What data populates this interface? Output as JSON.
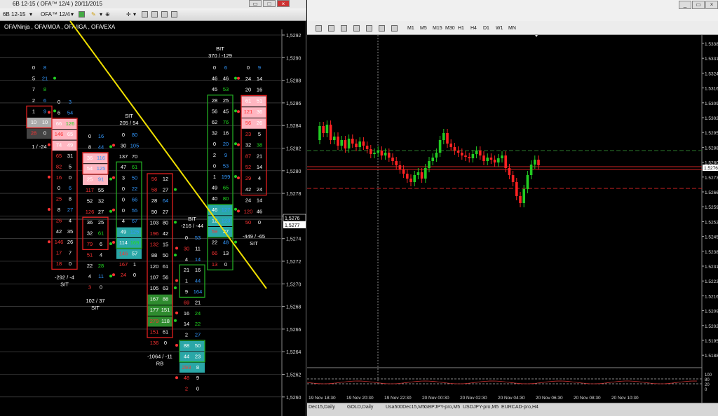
{
  "left": {
    "title": "6B 12-15 ( OFA™ 12/4 )  20/11/2015",
    "toolbar": {
      "symbol": "6B 12-15",
      "template": "OFA™ 12/4"
    },
    "subtitle": "OFA/Ninja , OFA/MOA , OFA/IGA , OFA/EXA",
    "price_axis": [
      "1,5292",
      "1,5290",
      "1,5288",
      "1,5286",
      "1,5284",
      "1,5282",
      "1,5280",
      "1,5278",
      "1,5276",
      "1,5274",
      "1,5272",
      "1,5270",
      "1,5268",
      "1,5266",
      "1,5264",
      "1,5262",
      "1,5260"
    ],
    "current_price": "1,5277",
    "last_price": "1,5276",
    "bars": [
      {
        "id": "bar1",
        "rows": [
          [
            "0",
            "8"
          ],
          [
            "5",
            "21"
          ],
          [
            "7",
            "8"
          ],
          [
            "2",
            "6"
          ],
          [
            "1",
            "9"
          ],
          [
            "10",
            "10"
          ],
          [
            "28",
            "0"
          ]
        ],
        "footer": "1 / -24"
      },
      {
        "id": "bar2",
        "rows": [
          [
            "0",
            "3"
          ],
          [
            "6",
            "54"
          ],
          [
            "66",
            "126"
          ],
          [
            "146",
            "65"
          ],
          [
            "74",
            "49"
          ],
          [
            "65",
            "31"
          ],
          [
            "82",
            "5"
          ],
          [
            "16",
            "0"
          ],
          [
            "0",
            "6"
          ],
          [
            "25",
            "8"
          ],
          [
            "8",
            "27"
          ],
          [
            "26",
            "4"
          ],
          [
            "42",
            "35"
          ],
          [
            "146",
            "26"
          ],
          [
            "17",
            "7"
          ],
          [
            "18",
            "0"
          ]
        ],
        "footer": "-292 / -4",
        "label": "SIT"
      },
      {
        "id": "bar3",
        "rows": [
          [
            "0",
            "16"
          ],
          [
            "8",
            "44"
          ],
          [
            "36",
            "116"
          ],
          [
            "54",
            "125"
          ],
          [
            "25",
            "91"
          ],
          [
            "117",
            "55"
          ],
          [
            "52",
            "32"
          ],
          [
            "126",
            "27"
          ],
          [
            "36",
            "25"
          ],
          [
            "32",
            "61"
          ],
          [
            "79",
            "6"
          ],
          [
            "51",
            "4"
          ],
          [
            "22",
            "28"
          ],
          [
            "4",
            "11"
          ],
          [
            "3",
            "0"
          ]
        ],
        "footer": "102 / 37",
        "label": "SIT"
      },
      {
        "id": "bar4",
        "header": "205 / 54",
        "top": "SIT",
        "rows": [
          [
            "0",
            "80"
          ],
          [
            "30",
            "105"
          ],
          [
            "137",
            "70"
          ],
          [
            "47",
            "61"
          ],
          [
            "3",
            "50"
          ],
          [
            "0",
            "22"
          ],
          [
            "0",
            "66"
          ],
          [
            "0",
            "55"
          ],
          [
            "4",
            "67"
          ],
          [
            "49",
            "125"
          ],
          [
            "114",
            "169"
          ],
          [
            "146",
            "57"
          ],
          [
            "167",
            "1"
          ],
          [
            "24",
            "0"
          ]
        ]
      },
      {
        "id": "bar5",
        "rows": [
          [
            "56",
            "12"
          ],
          [
            "58",
            "27"
          ],
          [
            "28",
            "64"
          ],
          [
            "50",
            "27"
          ],
          [
            "103",
            "80"
          ],
          [
            "196",
            "42"
          ],
          [
            "132",
            "15"
          ],
          [
            "88",
            "50"
          ],
          [
            "120",
            "61"
          ],
          [
            "107",
            "56"
          ],
          [
            "105",
            "63"
          ],
          [
            "167",
            "88"
          ],
          [
            "177",
            "151"
          ],
          [
            "279",
            "118"
          ],
          [
            "151",
            "61"
          ],
          [
            "136",
            "0"
          ]
        ],
        "footer": "-1064 / -11",
        "label": "RB"
      },
      {
        "id": "bar6",
        "header": "-216 / -44",
        "top": "BIT",
        "rows": [
          [
            "0",
            "53"
          ],
          [
            "30",
            "11"
          ],
          [
            "4",
            "14"
          ],
          [
            "21",
            "16"
          ],
          [
            "1",
            "44"
          ],
          [
            "9",
            "164"
          ],
          [
            "69",
            "21"
          ],
          [
            "16",
            "24"
          ],
          [
            "14",
            "22"
          ],
          [
            "2",
            "27"
          ],
          [
            "88",
            "50"
          ],
          [
            "44",
            "23"
          ],
          [
            "293",
            "8"
          ],
          [
            "48",
            "9"
          ],
          [
            "2",
            "0"
          ]
        ]
      },
      {
        "id": "bar7",
        "header": "370 / -129",
        "top": "BIT",
        "rows": [
          [
            "0",
            "6"
          ],
          [
            "46",
            "46"
          ],
          [
            "45",
            "53"
          ],
          [
            "28",
            "25"
          ],
          [
            "56",
            "45"
          ],
          [
            "62",
            "76"
          ],
          [
            "32",
            "16"
          ],
          [
            "0",
            "20"
          ],
          [
            "2",
            "9"
          ],
          [
            "0",
            "53"
          ],
          [
            "1",
            "199"
          ],
          [
            "49",
            "65"
          ],
          [
            "40",
            "80"
          ],
          [
            "46",
            "127"
          ],
          [
            "12",
            "123"
          ],
          [
            "59",
            "27"
          ],
          [
            "22",
            "48"
          ],
          [
            "66",
            "13"
          ],
          [
            "13",
            "0"
          ]
        ]
      },
      {
        "id": "bar8",
        "rows": [
          [
            "0",
            "9"
          ],
          [
            "24",
            "14"
          ],
          [
            "20",
            "16"
          ],
          [
            "61",
            "51"
          ],
          [
            "121",
            "36"
          ],
          [
            "56",
            "26"
          ],
          [
            "23",
            "5"
          ],
          [
            "32",
            "38"
          ],
          [
            "87",
            "21"
          ],
          [
            "52",
            "14"
          ],
          [
            "29",
            "4"
          ],
          [
            "42",
            "24"
          ],
          [
            "24",
            "14"
          ],
          [
            "120",
            "46"
          ],
          [
            "50",
            "0"
          ]
        ],
        "footer": "-449 / -65",
        "label": "SIT"
      }
    ]
  },
  "right": {
    "toolbar_timeframes": [
      "M1",
      "M5",
      "M15",
      "M30",
      "H1",
      "H4",
      "D1",
      "W1",
      "MN"
    ],
    "price_axis": [
      "1.5338",
      "1.5331",
      "1.5324",
      "1.5316",
      "1.5309",
      "1.5302",
      "1.5295",
      "1.5288",
      "1.5280",
      "1.5273",
      "1.5266",
      "1.5259",
      "1.5252",
      "1.5245",
      "1.5238",
      "1.5231",
      "1.5223",
      "1.5216",
      "1.5209",
      "1.5202",
      "1.5195",
      "1.5188"
    ],
    "current_price": "1.5276",
    "time_axis": [
      "19 Nov 18:30",
      "19 Nov 20:30",
      "19 Nov 22:30",
      "20 Nov 00:30",
      "20 Nov 02:30",
      "20 Nov 04:30",
      "20 Nov 06:30",
      "20 Nov 08:30",
      "20 Nov 10:30"
    ],
    "indicator_axis": [
      "100",
      "80",
      "20",
      "0"
    ],
    "tabs": [
      "Dec15,Daily",
      "GOLD,Daily",
      "Usa500Dec15,M5",
      "GBPJPY-pro,M5",
      "USDJPY-pro,M5",
      "EURCAD-pro,H4"
    ]
  },
  "colors": {
    "ask_red": "#ff3333",
    "bid_blue": "#3399ff",
    "highlight_pink": "#ffb6c1",
    "highlight_teal": "#2aa7a7",
    "highlight_green": "#2e8b2e",
    "box_red": "#e02020",
    "box_green": "#22aa22",
    "trendline_yellow": "#f0e000",
    "candle_up": "#22cc22",
    "candle_down": "#ff2222"
  }
}
